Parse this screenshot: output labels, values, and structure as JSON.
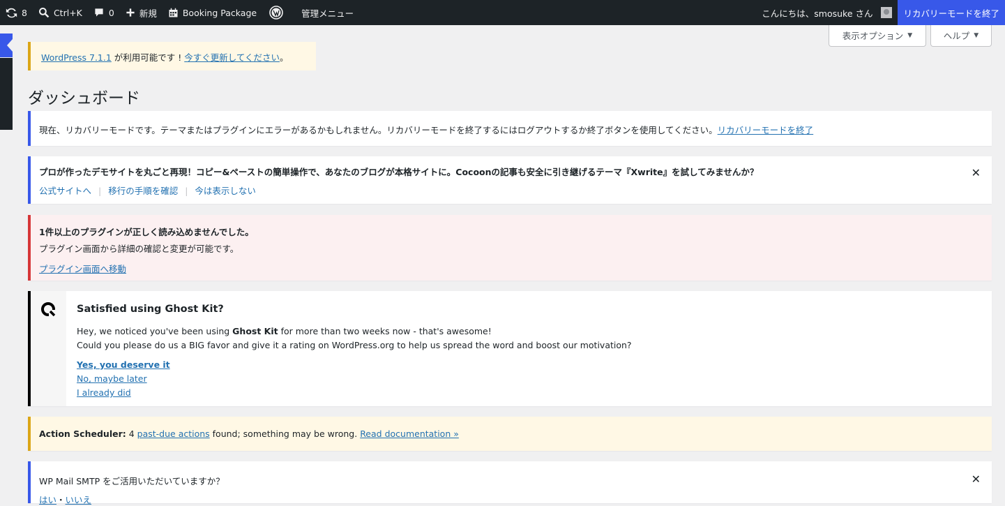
{
  "adminbar": {
    "updates_count": "8",
    "search_label": "Ctrl+K",
    "comments_count": "0",
    "new_label": "新規",
    "booking_label": "Booking Package",
    "admin_menu_label": "管理メニュー",
    "greeting": "こんにちは、smosuke さん",
    "recovery_exit": "リカバリーモードを終了"
  },
  "screen_meta": {
    "options_label": "表示オプション",
    "help_label": "ヘルプ"
  },
  "update_nag": {
    "version_link": "WordPress 7.1.1",
    "middle_text": " が利用可能です ! ",
    "update_link": "今すぐ更新してください",
    "end": "。"
  },
  "page_title": "ダッシュボード",
  "recovery_notice": {
    "text": "現在、リカバリーモードです。テーマまたはプラグインにエラーがあるかもしれません。リカバリーモードを終了するにはログアウトするか終了ボタンを使用してください。",
    "link": "リカバリーモードを終了"
  },
  "xwrite_notice": {
    "text": "プロが作ったデモサイトを丸ごと再現！コピー&ペーストの簡単操作で、あなたのブログが本格サイトに。Cocoonの記事も安全に引き継げるテーマ『Xwrite』を試してみませんか？",
    "link1": "公式サイトへ",
    "link2": "移行の手順を確認",
    "link3": "今は表示しない",
    "sep": "|",
    "dismiss": "✕"
  },
  "plugin_notice": {
    "title": "1件以上のプラグインが正しく読み込めませんでした。",
    "desc": "プラグイン画面から詳細の確認と変更が可能です。",
    "link": "プラグイン画面へ移動"
  },
  "ghost_notice": {
    "title": "Satisfied using Ghost Kit?",
    "p1_a": "Hey, we noticed you've been using ",
    "p1_b": "Ghost Kit",
    "p1_c": " for more than two weeks now - that's awesome!",
    "p2": "Could you please do us a BIG favor and give it a rating on WordPress.org to help us spread the word and boost our motivation?",
    "link_yes": "Yes, you deserve it",
    "link_later": "No, maybe later",
    "link_did": "I already did"
  },
  "action_notice": {
    "label": "Action Scheduler:",
    "count": " 4 ",
    "link1": "past-due actions",
    "middle": " found; something may be wrong. ",
    "link2": "Read documentation »"
  },
  "smtp_notice": {
    "text": "WP Mail SMTP をご活用いただいていますか？",
    "yes": "はい",
    "no": "いいえ",
    "dot": "・",
    "dismiss": "✕"
  }
}
